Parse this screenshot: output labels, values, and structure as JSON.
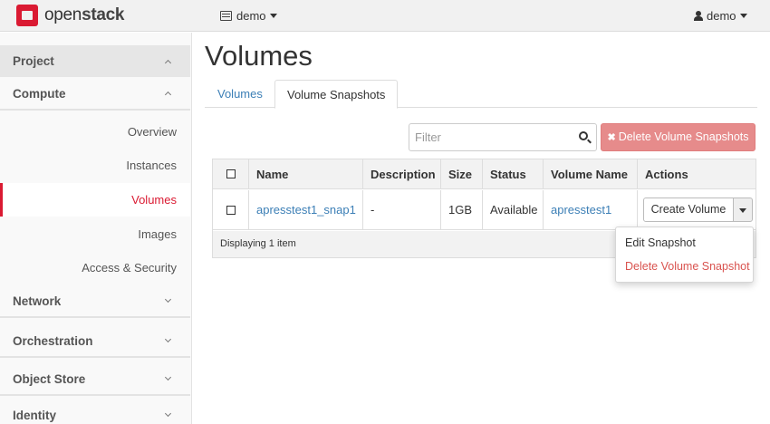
{
  "topbar": {
    "brand_prefix": "open",
    "brand_suffix": "stack",
    "project_selector": "demo",
    "user_menu": "demo"
  },
  "sidebar": {
    "project": "Project",
    "compute": "Compute",
    "items": [
      "Overview",
      "Instances",
      "Volumes",
      "Images",
      "Access & Security"
    ],
    "active_item": "Volumes",
    "sections": [
      "Network",
      "Orchestration",
      "Object Store",
      "Identity"
    ]
  },
  "main": {
    "title": "Volumes",
    "tabs": [
      "Volumes",
      "Volume Snapshots"
    ],
    "active_tab": "Volume Snapshots",
    "filter_placeholder": "Filter",
    "delete_button": "Delete Volume Snapshots"
  },
  "table": {
    "headers": [
      "Name",
      "Description",
      "Size",
      "Status",
      "Volume Name",
      "Actions"
    ],
    "rows": [
      {
        "name": "apresstest1_snap1",
        "description": "-",
        "size": "1GB",
        "status": "Available",
        "volume_name": "apresstest1",
        "action": "Create Volume"
      }
    ],
    "footer": "Displaying 1 item"
  },
  "actions_menu": {
    "items": [
      "Edit Snapshot",
      "Delete Volume Snapshot"
    ]
  },
  "colors": {
    "brand": "#da1a32",
    "link": "#3c7fb6",
    "danger_button": "#e68b8b",
    "danger_text": "#d9534f"
  }
}
